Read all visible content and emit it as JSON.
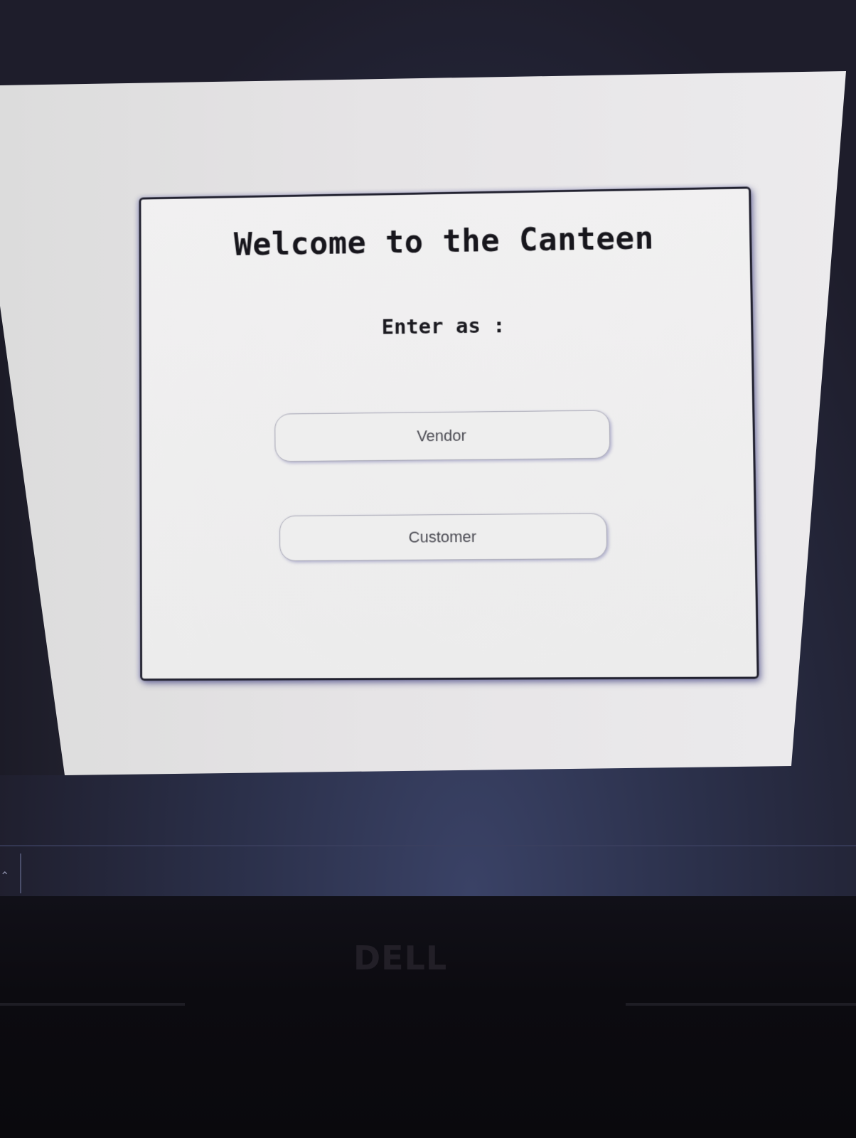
{
  "dialog": {
    "title": "Welcome to the Canteen",
    "subtitle": "Enter as :",
    "buttons": [
      {
        "label": "Vendor"
      },
      {
        "label": "Customer"
      }
    ]
  },
  "device": {
    "logo": "DELL"
  },
  "colors": {
    "page_background": "#e6e4e6",
    "card_border": "#222230",
    "button_border": "#a9a9b6",
    "screen_surround": "#1e1d2b"
  },
  "icons": {
    "taskbar_caret": "chevron-up-icon"
  }
}
